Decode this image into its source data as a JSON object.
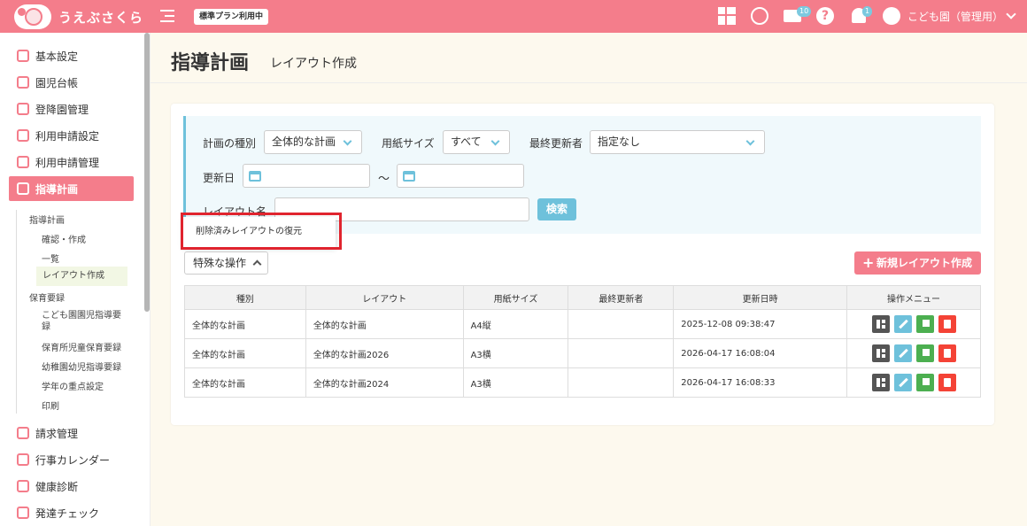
{
  "header": {
    "app_name": "うえぶさくら",
    "plan_badge": "標準プラン利用中",
    "mail_count": "10",
    "notification_count": "1",
    "user_name": "こども園（管理用）"
  },
  "sidebar": {
    "items": [
      {
        "label": "基本設定"
      },
      {
        "label": "園児台帳"
      },
      {
        "label": "登降園管理"
      },
      {
        "label": "利用申請設定"
      },
      {
        "label": "利用申請管理"
      },
      {
        "label": "指導計画"
      }
    ],
    "sub_group_1": "指導計画",
    "sub_items_1": [
      "確認・作成",
      "一覧",
      "レイアウト作成"
    ],
    "sub_group_2": "保育要録",
    "sub_items_2": [
      "こども園園児指導要録",
      "保育所児童保育要録",
      "幼稚園幼児指導要録",
      "学年の重点設定",
      "印刷"
    ],
    "bottom_items": [
      {
        "label": "請求管理"
      },
      {
        "label": "行事カレンダー"
      },
      {
        "label": "健康診断"
      },
      {
        "label": "発達チェック"
      }
    ]
  },
  "page": {
    "title": "指導計画",
    "subtitle": "レイアウト作成"
  },
  "filters": {
    "plan_type_label": "計画の種別",
    "plan_type_value": "全体的な計画",
    "paper_size_label": "用紙サイズ",
    "paper_size_value": "すべて",
    "updater_label": "最終更新者",
    "updater_value": "指定なし",
    "updated_label": "更新日",
    "range_sep": "〜",
    "layout_name_label": "レイアウト名",
    "search_button": "検索"
  },
  "popover": {
    "restore_item": "削除済みレイアウトの復元"
  },
  "actions": {
    "special_ops": "特殊な操作",
    "new_layout": "新規レイアウト作成"
  },
  "table": {
    "headers": [
      "種別",
      "レイアウト",
      "用紙サイズ",
      "最終更新者",
      "更新日時",
      "操作メニュー"
    ],
    "rows": [
      [
        "全体的な計画",
        "全体的な計画",
        "A4縦",
        "",
        "2025-12-08 09:38:47"
      ],
      [
        "全体的な計画",
        "全体的な計画2026",
        "A3横",
        "",
        "2026-04-17 16:08:04"
      ],
      [
        "全体的な計画",
        "全体的な計画2024",
        "A3横",
        "",
        "2026-04-17 16:08:33"
      ]
    ]
  },
  "colors": {
    "brand": "#f47d8b",
    "accent": "#6ec1db",
    "highlight": "#e0242e"
  }
}
